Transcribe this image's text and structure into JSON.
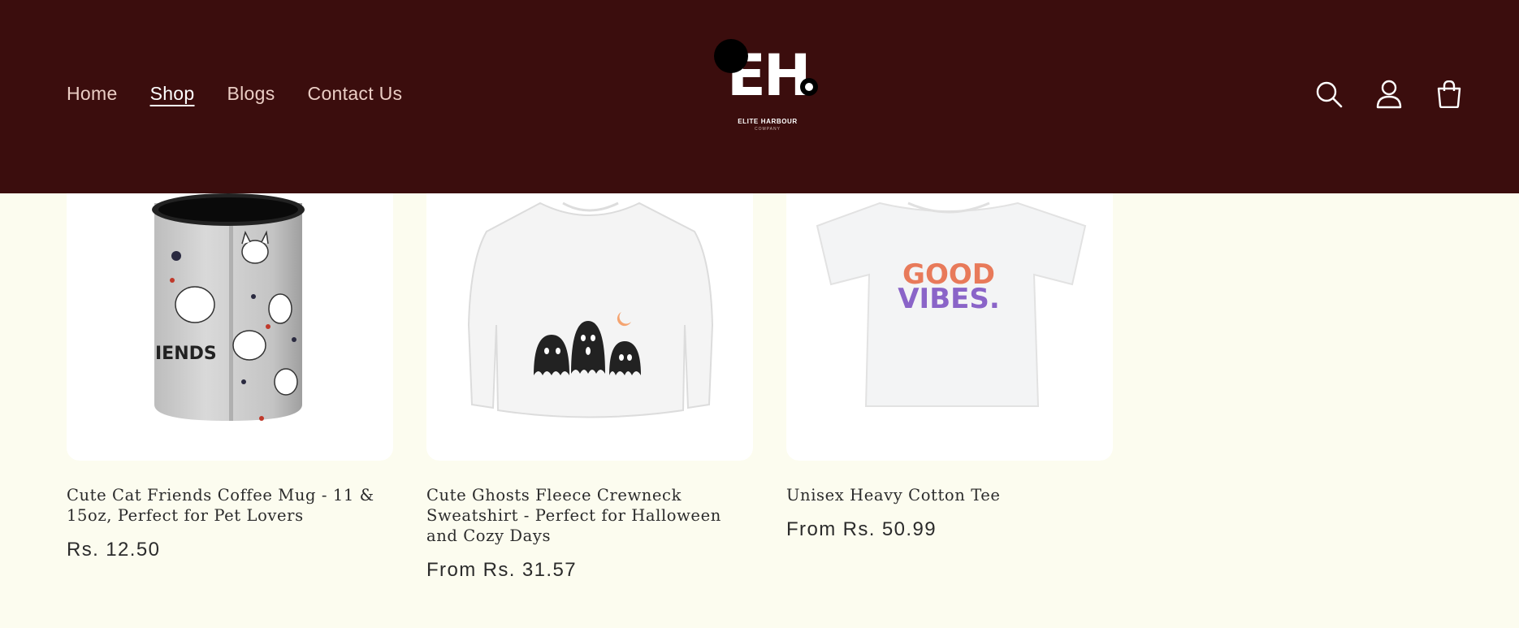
{
  "header": {
    "nav": [
      {
        "label": "Home",
        "active": false
      },
      {
        "label": "Shop",
        "active": true
      },
      {
        "label": "Blogs",
        "active": false
      },
      {
        "label": "Contact Us",
        "active": false
      }
    ],
    "logo": {
      "letters": "EH",
      "name": "ELITE HARBOUR",
      "sub": "COMPANY"
    },
    "icons": [
      "search-icon",
      "account-icon",
      "cart-icon"
    ],
    "background": "#3b0d0d"
  },
  "products": [
    {
      "title": "Cute Cat Friends Coffee Mug - 11 & 15oz, Perfect for Pet Lovers",
      "price": "Rs. 12.50",
      "image": "mug-image",
      "image_text": "IENDS"
    },
    {
      "title": "Cute Ghosts Fleece Crewneck Sweatshirt - Perfect for Halloween and Cozy Days",
      "price": "From Rs. 31.57",
      "image": "sweatshirt-image"
    },
    {
      "title": "Unisex Heavy Cotton Tee",
      "price": "From Rs. 50.99",
      "image": "tee-image",
      "image_text": [
        "GOOD",
        "VIBES."
      ]
    }
  ],
  "colors": {
    "page_background": "#fcfcef",
    "card_background": "#ffffff"
  }
}
